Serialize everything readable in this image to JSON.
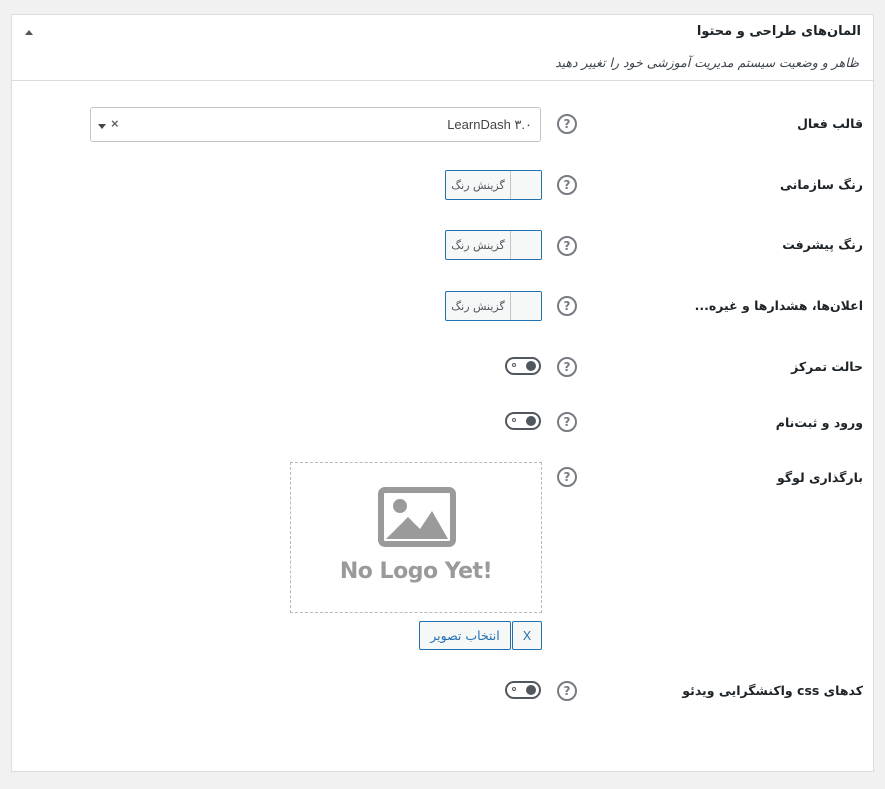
{
  "panel": {
    "title": "المان‌های طراحی و محتوا",
    "description": "ظاهر و وضعیت سیستم مدیریت آموزشی خود را تغییر دهید"
  },
  "rows": {
    "template": {
      "label": "قالب فعال",
      "selected_value": "LearnDash ۳.۰",
      "clear_symbol": "×"
    },
    "org_color": {
      "label": "رنگ سازمانی",
      "button_label": "گزینش رنگ"
    },
    "progress_color": {
      "label": "رنگ پیشرفت",
      "button_label": "گزینش رنگ"
    },
    "notices_color": {
      "label": "اعلان‌ها، هشدارها و غیره...",
      "button_label": "گزینش رنگ"
    },
    "focus_mode": {
      "label": "حالت تمرکز",
      "enabled": false
    },
    "login_register": {
      "label": "ورود و ثبت‌نام",
      "enabled": false
    },
    "logo_upload": {
      "label": "بارگذاری لوگو",
      "placeholder_text": "No Logo Yet!",
      "select_button": "انتخاب تصویر",
      "remove_button": "X"
    },
    "responsive_video": {
      "label": "کدهای css واکنشگرایی ویدئو",
      "enabled": false
    }
  },
  "help_symbol": "?",
  "colors": {
    "accent": "#2271b1",
    "border": "#c3c4c7",
    "text": "#1d2327"
  }
}
